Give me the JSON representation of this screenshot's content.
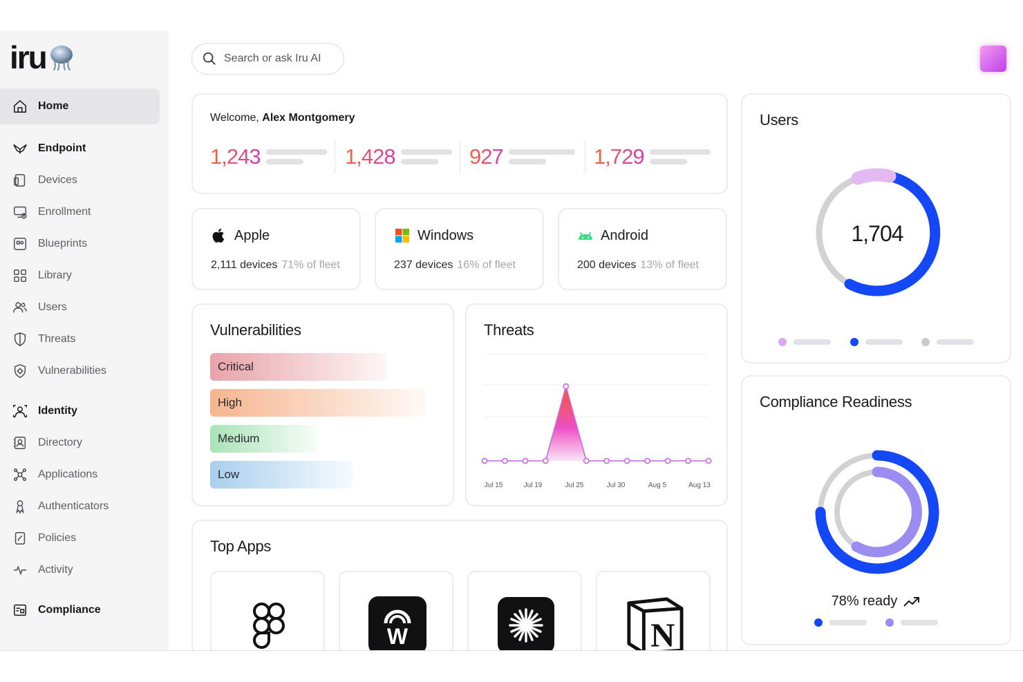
{
  "brand": {
    "name": "iru"
  },
  "search": {
    "placeholder": "Search or ask Iru AI"
  },
  "sidebar": {
    "items": [
      {
        "label": "Home",
        "icon": "home-icon"
      },
      {
        "label": "Endpoint",
        "icon": "endpoint-icon"
      },
      {
        "label": "Devices",
        "icon": "devices-icon"
      },
      {
        "label": "Enrollment",
        "icon": "enrollment-icon"
      },
      {
        "label": "Blueprints",
        "icon": "blueprints-icon"
      },
      {
        "label": "Library",
        "icon": "library-icon"
      },
      {
        "label": "Users",
        "icon": "users-icon"
      },
      {
        "label": "Threats",
        "icon": "shield-icon"
      },
      {
        "label": "Vulnerabilities",
        "icon": "vulnerability-shield-icon"
      },
      {
        "label": "Identity",
        "icon": "identity-icon"
      },
      {
        "label": "Directory",
        "icon": "directory-icon"
      },
      {
        "label": "Applications",
        "icon": "applications-icon"
      },
      {
        "label": "Authenticators",
        "icon": "authenticators-icon"
      },
      {
        "label": "Policies",
        "icon": "policies-icon"
      },
      {
        "label": "Activity",
        "icon": "activity-icon"
      },
      {
        "label": "Compliance",
        "icon": "compliance-icon"
      }
    ]
  },
  "welcome": {
    "prefix": "Welcome, ",
    "name": "Alex Montgomery",
    "stats": [
      "1,243",
      "1,428",
      "927",
      "1,729"
    ]
  },
  "os_cards": [
    {
      "name": "Apple",
      "devices": "2,111 devices",
      "share": "71% of fleet",
      "icon": "apple-icon"
    },
    {
      "name": "Windows",
      "devices": "237 devices",
      "share": "16% of fleet",
      "icon": "windows-icon"
    },
    {
      "name": "Android",
      "devices": "200 devices",
      "share": "13% of fleet",
      "icon": "android-icon"
    }
  ],
  "vulnerabilities": {
    "title": "Vulnerabilities",
    "levels": [
      {
        "label": "Critical",
        "color": "#e8a3a9"
      },
      {
        "label": "High",
        "color": "#f7b58f"
      },
      {
        "label": "Medium",
        "color": "#a9e3b6"
      },
      {
        "label": "Low",
        "color": "#a9cfee"
      }
    ]
  },
  "threats": {
    "title": "Threats",
    "chart_data": {
      "type": "line",
      "x": [
        "Jul 15",
        "",
        "Jul 19",
        "",
        "Jul 25",
        "",
        "",
        "Jul 30",
        "",
        "Aug 5",
        "",
        "Aug 13"
      ],
      "values": [
        0,
        0,
        0,
        0,
        7,
        0,
        0,
        0,
        0,
        0,
        0,
        0
      ],
      "tick_labels": [
        "Jul 15",
        "Jul 19",
        "Jul 25",
        "Jul 30",
        "Aug 5",
        "Aug 13"
      ],
      "title": "Threats",
      "xlabel": "",
      "ylabel": "",
      "ylim": [
        0,
        10
      ],
      "grid": true
    }
  },
  "top_apps": {
    "title": "Top Apps",
    "apps": [
      {
        "icon": "figma-icon"
      },
      {
        "icon": "webex-icon"
      },
      {
        "icon": "perplexity-icon"
      },
      {
        "icon": "notion-icon"
      }
    ]
  },
  "users": {
    "title": "Users",
    "total": "1,704",
    "legend_colors": [
      "#d7a9ee",
      "#1447f5",
      "#c9c9cf"
    ]
  },
  "compliance": {
    "title": "Compliance Readiness",
    "ready_label": "78% ready",
    "ready_percent": 78,
    "legend_colors": [
      "#1447f5",
      "#9a8cf0"
    ]
  }
}
